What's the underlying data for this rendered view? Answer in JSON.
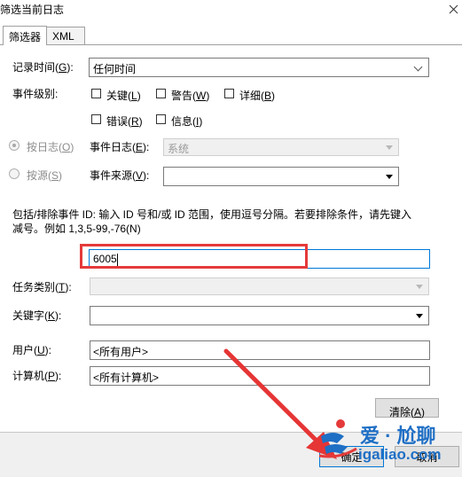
{
  "window": {
    "title": "筛选当前日志"
  },
  "tabs": [
    {
      "label": "筛选器"
    },
    {
      "label": "XML"
    }
  ],
  "filter": {
    "logged_label": "记录时间(",
    "logged_key": "G",
    "logged_suffix": "):",
    "logged_value": "任何时间",
    "level_label": "事件级别:",
    "levels": {
      "critical": {
        "text": "关键(",
        "key": "L",
        "end": ")"
      },
      "warning": {
        "text": "警告(",
        "key": "W",
        "end": ")"
      },
      "verbose": {
        "text": "详细(",
        "key": "B",
        "end": ")"
      },
      "error": {
        "text": "错误(",
        "key": "R",
        "end": ")"
      },
      "information": {
        "text": "信息(",
        "key": "I",
        "end": ")"
      }
    },
    "by_log": {
      "text": "按日志(",
      "key": "O",
      "end": ")"
    },
    "by_source": {
      "text": "按源(",
      "key": "S",
      "end": ")"
    },
    "event_logs_label": "事件日志(",
    "event_logs_key": "E",
    "event_logs_suffix": "):",
    "event_logs_value": "系统",
    "event_sources_label": "事件来源(",
    "event_sources_key": "V",
    "event_sources_suffix": "):",
    "event_sources_value": "",
    "description_line1": "包括/排除事件 ID: 输入 ID 号和/或 ID 范围，使用逗号分隔。若要排除条件，请先键入",
    "description_line2": "减号。例如 1,3,5-99,-76(N)",
    "event_id_value": "6005",
    "task_category_label": "任务类别(",
    "task_category_key": "T",
    "task_category_suffix": "):",
    "keywords_label": "关键字(",
    "keywords_key": "K",
    "keywords_suffix": "):",
    "user_label": "用户(",
    "user_key": "U",
    "user_suffix": "):",
    "user_value": "<所有用户>",
    "computer_label": "计算机(",
    "computer_key": "P",
    "computer_suffix": "):",
    "computer_value": "<所有计算机>",
    "clear_text": "清除(",
    "clear_key": "A",
    "clear_end": ")"
  },
  "footer": {
    "ok_label": "确定",
    "cancel_label": "取消"
  },
  "watermark": {
    "brand": "爱 · 尬聊",
    "url": "igaliao.com"
  },
  "colors": {
    "highlight": "#e53a3a",
    "arrow": "#e63535",
    "brand_blue": "#1f6fc5",
    "focus_blue": "#0078d7"
  }
}
